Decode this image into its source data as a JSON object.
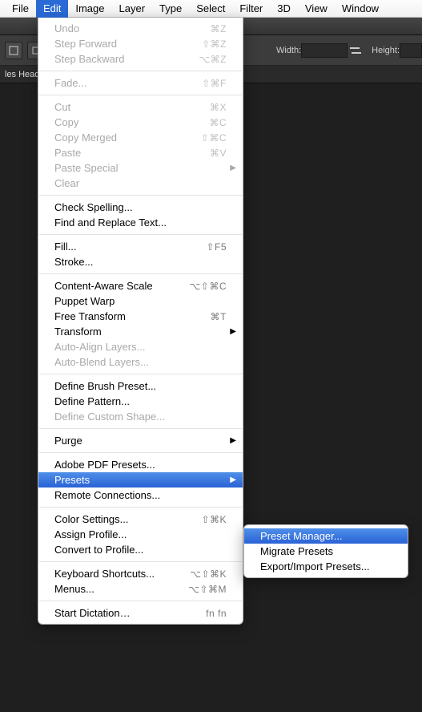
{
  "menubar": {
    "items": [
      "File",
      "Edit",
      "Image",
      "Layer",
      "Type",
      "Select",
      "Filter",
      "3D",
      "View",
      "Window"
    ],
    "active_index": 1
  },
  "options_bar": {
    "width_label": "Width:",
    "height_label": "Height:"
  },
  "tab": {
    "label": "les Heade"
  },
  "edit_menu": {
    "groups": [
      [
        {
          "label": "Undo",
          "shortcut": "⌘Z",
          "disabled": true
        },
        {
          "label": "Step Forward",
          "shortcut": "⇧⌘Z",
          "disabled": true
        },
        {
          "label": "Step Backward",
          "shortcut": "⌥⌘Z",
          "disabled": true
        }
      ],
      [
        {
          "label": "Fade...",
          "shortcut": "⇧⌘F",
          "disabled": true
        }
      ],
      [
        {
          "label": "Cut",
          "shortcut": "⌘X",
          "disabled": true
        },
        {
          "label": "Copy",
          "shortcut": "⌘C",
          "disabled": true
        },
        {
          "label": "Copy Merged",
          "shortcut": "⇧⌘C",
          "disabled": true
        },
        {
          "label": "Paste",
          "shortcut": "⌘V",
          "disabled": true
        },
        {
          "label": "Paste Special",
          "submenu": true,
          "disabled": true
        },
        {
          "label": "Clear",
          "disabled": true
        }
      ],
      [
        {
          "label": "Check Spelling..."
        },
        {
          "label": "Find and Replace Text..."
        }
      ],
      [
        {
          "label": "Fill...",
          "shortcut": "⇧F5"
        },
        {
          "label": "Stroke..."
        }
      ],
      [
        {
          "label": "Content-Aware Scale",
          "shortcut": "⌥⇧⌘C"
        },
        {
          "label": "Puppet Warp"
        },
        {
          "label": "Free Transform",
          "shortcut": "⌘T"
        },
        {
          "label": "Transform",
          "submenu": true
        },
        {
          "label": "Auto-Align Layers...",
          "disabled": true
        },
        {
          "label": "Auto-Blend Layers...",
          "disabled": true
        }
      ],
      [
        {
          "label": "Define Brush Preset..."
        },
        {
          "label": "Define Pattern..."
        },
        {
          "label": "Define Custom Shape...",
          "disabled": true
        }
      ],
      [
        {
          "label": "Purge",
          "submenu": true
        }
      ],
      [
        {
          "label": "Adobe PDF Presets..."
        },
        {
          "label": "Presets",
          "submenu": true,
          "highlight": true
        },
        {
          "label": "Remote Connections..."
        }
      ],
      [
        {
          "label": "Color Settings...",
          "shortcut": "⇧⌘K"
        },
        {
          "label": "Assign Profile..."
        },
        {
          "label": "Convert to Profile..."
        }
      ],
      [
        {
          "label": "Keyboard Shortcuts...",
          "shortcut": "⌥⇧⌘K"
        },
        {
          "label": "Menus...",
          "shortcut": "⌥⇧⌘M"
        }
      ],
      [
        {
          "label": "Start Dictation…",
          "shortcut": "fn fn"
        }
      ]
    ]
  },
  "presets_submenu": {
    "items": [
      {
        "label": "Preset Manager...",
        "highlight": true
      },
      {
        "label": "Migrate Presets"
      },
      {
        "label": "Export/Import Presets..."
      }
    ]
  }
}
